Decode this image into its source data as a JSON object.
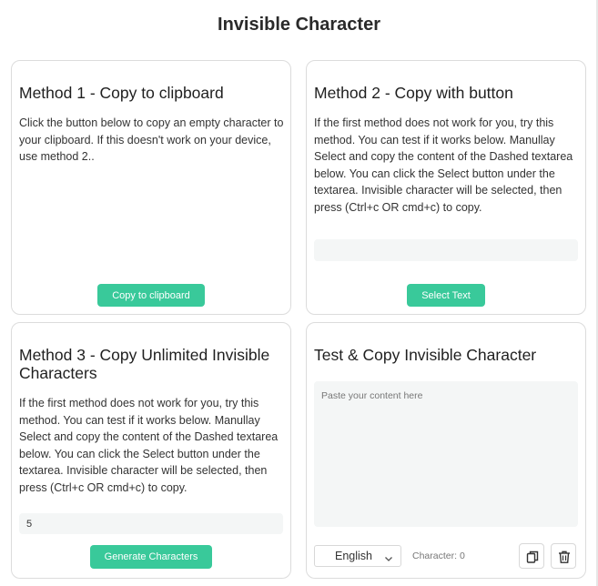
{
  "page": {
    "title": "Invisible Character"
  },
  "method1": {
    "heading": "Method 1 - Copy to clipboard",
    "description": "Click the button below to copy an empty character to your clipboard. If this doesn't work on your device, use method 2..",
    "button_label": "Copy to clipboard"
  },
  "method2": {
    "heading": "Method 2 - Copy with button",
    "description": "If the first method does not work for you, try this method. You can test if it works below. Manullay Select and copy the content of the Dashed textarea below. You can click the Select button under the textarea. Invisible character will be selected, then press (Ctrl+c OR cmd+c) to copy.",
    "button_label": "Select Text"
  },
  "method3": {
    "heading": "Method 3 - Copy Unlimited Invisible Characters",
    "description": "If the first method does not work for you, try this method. You can test if it works below. Manullay Select and copy the content of the Dashed textarea below. You can click the Select button under the textarea. Invisible character will be selected, then press (Ctrl+c OR cmd+c) to copy.",
    "count_value": "5",
    "button_label": "Generate Characters"
  },
  "tester": {
    "heading": "Test & Copy Invisible Character",
    "placeholder": "Paste your content here",
    "language": "English",
    "counter_label": "Character:",
    "counter_value": "0",
    "icons": {
      "copy": "copy-icon",
      "delete": "trash-icon"
    }
  },
  "colors": {
    "accent": "#39c99a",
    "field_bg": "#f4f6f6",
    "border": "#dcdcdc"
  }
}
